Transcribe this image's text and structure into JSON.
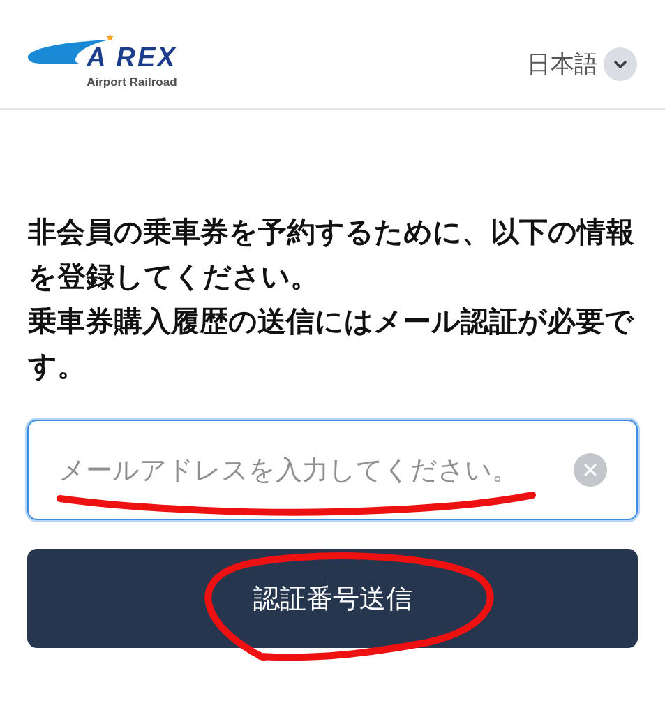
{
  "header": {
    "logo": {
      "wordmark_parts": [
        "A",
        "REX"
      ],
      "tagline": "Airport Railroad"
    },
    "language": {
      "label": "日本語"
    }
  },
  "instructions": [
    "非会員の乗車券を予約するために、以下の情報を登録してください。",
    "乗車券購入履歴の送信にはメール認証が必要です。"
  ],
  "email_field": {
    "placeholder": "メールアドレスを入力してください。",
    "hand_drawn_underline": true
  },
  "send_button": {
    "label": "認証番号送信",
    "hand_drawn_circle": true
  }
}
